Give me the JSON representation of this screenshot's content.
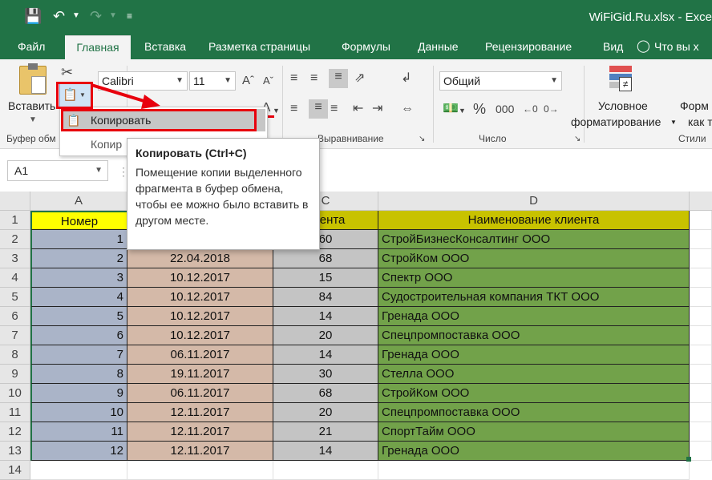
{
  "titlebar": {
    "title": "WiFiGid.Ru.xlsx - Exce"
  },
  "tabs": [
    "Файл",
    "Главная",
    "Вставка",
    "Разметка страницы",
    "Формулы",
    "Данные",
    "Рецензирование",
    "Вид"
  ],
  "tell_me": "Что вы х",
  "ribbon": {
    "paste_label": "Вставить",
    "clipboard_label": "Буфер обм",
    "font_name": "Calibri",
    "font_size": "11",
    "alignment_label": "Выравнивание",
    "number_format": "Общий",
    "number_label": "Число",
    "cond_format_line1": "Условное",
    "cond_format_line2": "форматирование",
    "format_table_line1": "Форм",
    "format_table_line2": "как т",
    "styles_label": "Стили",
    "percent": "%",
    "comma": "000"
  },
  "dropdown": {
    "item1": "Копировать",
    "item2": "Копир"
  },
  "tooltip": {
    "title": "Копировать (Ctrl+C)",
    "description": "Помещение копии выделенного фрагмента в буфер обмена, чтобы ее можно было вставить в другом месте."
  },
  "namebox": "A1",
  "columns": [
    "A",
    "B",
    "C",
    "D"
  ],
  "headers": {
    "a": "Номер",
    "c": "лиента",
    "d": "Наименование клиента"
  },
  "rows": [
    {
      "n": "2",
      "a": "1",
      "b": "",
      "c": "60",
      "d": "СтройБизнесКонсалтинг ООО"
    },
    {
      "n": "3",
      "a": "2",
      "b": "22.04.2018",
      "c": "68",
      "d": "СтройКом ООО"
    },
    {
      "n": "4",
      "a": "3",
      "b": "10.12.2017",
      "c": "15",
      "d": "Спектр ООО"
    },
    {
      "n": "5",
      "a": "4",
      "b": "10.12.2017",
      "c": "84",
      "d": "Судостроительная компания ТКТ ООО"
    },
    {
      "n": "6",
      "a": "5",
      "b": "10.12.2017",
      "c": "14",
      "d": "Гренада ООО"
    },
    {
      "n": "7",
      "a": "6",
      "b": "10.12.2017",
      "c": "20",
      "d": "Спецпромпоставка ООО"
    },
    {
      "n": "8",
      "a": "7",
      "b": "06.11.2017",
      "c": "14",
      "d": "Гренада ООО"
    },
    {
      "n": "9",
      "a": "8",
      "b": "19.11.2017",
      "c": "30",
      "d": "Стелла ООО"
    },
    {
      "n": "10",
      "a": "9",
      "b": "06.11.2017",
      "c": "68",
      "d": "СтройКом ООО"
    },
    {
      "n": "11",
      "a": "10",
      "b": "12.11.2017",
      "c": "20",
      "d": "Спецпромпоставка ООО"
    },
    {
      "n": "12",
      "a": "11",
      "b": "12.11.2017",
      "c": "21",
      "d": "СпортТайм ООО"
    },
    {
      "n": "13",
      "a": "12",
      "b": "12.11.2017",
      "c": "14",
      "d": "Гренада ООО"
    }
  ],
  "row1": "1",
  "row14": "14",
  "colors": {
    "excel_green": "#217346",
    "highlight_red": "#e8000d"
  }
}
